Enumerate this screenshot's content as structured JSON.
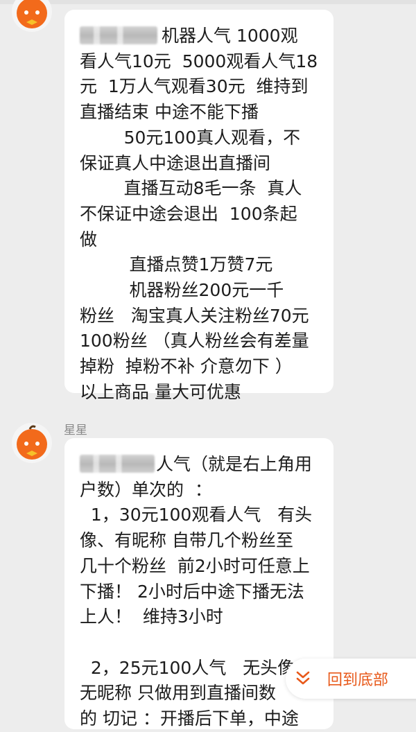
{
  "chat": {
    "messages": [
      {
        "sender": "",
        "lines": [
          "机器人气 1000观",
          "看人气10元  5000观看人气18",
          "元  1万人气观看30元  维持到",
          "直播结束 中途不能下播",
          "        50元100真人观看，不",
          "保证真人中途退出直播间",
          "        直播互动8毛一条  真人",
          "不保证中途会退出  100条起",
          "做",
          "         直播点赞1万赞7元",
          "         机器粉丝200元一千",
          "粉丝   淘宝真人关注粉丝70元",
          "100粉丝 （真人粉丝会有差量",
          "掉粉  掉粉不补 介意勿下 ）",
          "以上商品 量大可优惠"
        ]
      },
      {
        "sender": "星星",
        "lines": [
          "人气（就是右上角用",
          "户数）单次的  ：",
          "  1，30元100观看人气   有头",
          "像、有昵称 自带几个粉丝至",
          "几十个粉丝  前2小时可任意上",
          "下播！ 2小时后中途下播无法",
          "上人！  维持3小时",
          "",
          "  2，25元100人气   无头像",
          "无昵称 只做用到直播间数",
          "的 切记 ：开播后下单，中途"
        ]
      }
    ]
  },
  "jump_button": {
    "label": "回到底部",
    "icon": "double-chevron-down-icon",
    "color": "#e8591a"
  },
  "avatar": {
    "icon": "orange-mascot-icon",
    "color": "#f26a1b"
  }
}
